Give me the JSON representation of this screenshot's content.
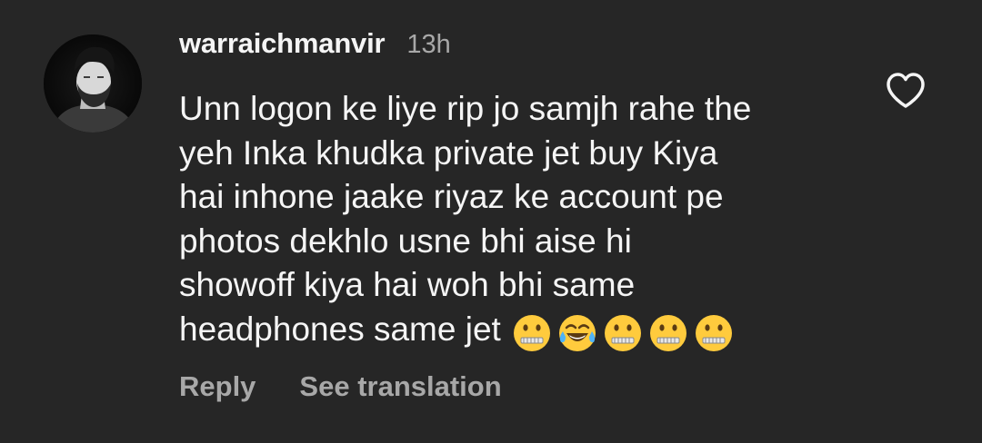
{
  "comment": {
    "username": "warraichmanvir",
    "timestamp": "13h",
    "avatar_icon": "profile-photo-avatar",
    "lines": [
      "Unn logon ke liye rip jo samjh rahe the",
      "yeh Inka khudka private jet buy Kiya",
      "hai inhone jaake riyaz ke account pe",
      "photos dekhlo usne bhi aise hi",
      "showoff kiya hai woh bhi same",
      "headphones same jet"
    ],
    "emojis": [
      "zipper-mouth-face",
      "face-with-tears-of-joy",
      "zipper-mouth-face",
      "zipper-mouth-face",
      "zipper-mouth-face"
    ],
    "like_icon": "heart-outline-icon",
    "actions": {
      "reply_label": "Reply",
      "translate_label": "See translation"
    }
  },
  "colors": {
    "background": "#262626",
    "primary_text": "#f5f5f5",
    "secondary_text": "#a8a8a8",
    "emoji_yellow": "#ffcb3d"
  }
}
